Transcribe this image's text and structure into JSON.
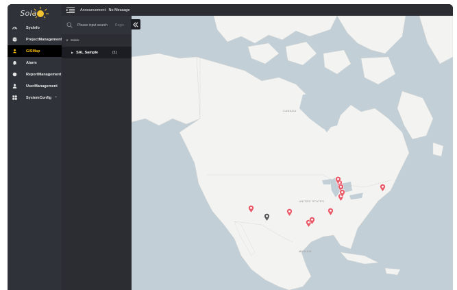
{
  "app": {
    "logo_text": "Sola"
  },
  "nav": {
    "items": [
      {
        "label": "SysInfo",
        "icon": "gauge-icon"
      },
      {
        "label": "ProjectManagement",
        "icon": "database-icon"
      },
      {
        "label": "GISMap",
        "icon": "map-users-icon",
        "active": true
      },
      {
        "label": "Alarm",
        "icon": "bell-icon"
      },
      {
        "label": "ReportManagement",
        "icon": "pie-chart-icon"
      },
      {
        "label": "UserManagement",
        "icon": "user-icon",
        "has_submenu": true
      },
      {
        "label": "SystemConfig",
        "icon": "grid-icon",
        "has_submenu": true
      }
    ]
  },
  "topbar": {
    "announcement_label": "Announcement:",
    "announcement_value": "No Message"
  },
  "panel": {
    "search_placeholder": "Please input search",
    "search_button": "Regio",
    "root_label": "Solelo",
    "node_label": "SAL Sample",
    "node_count": "(1)"
  },
  "map": {
    "labels": {
      "canada": "CANADA",
      "united_states": "UNITED STATES",
      "mexico": "MEXICO"
    },
    "pin_color": "#e85a67",
    "pin_count": 14
  },
  "colors": {
    "accent": "#ffc107",
    "sidebar": "#30323a",
    "water": "#c3cfd6",
    "land": "#f3f3f1"
  }
}
